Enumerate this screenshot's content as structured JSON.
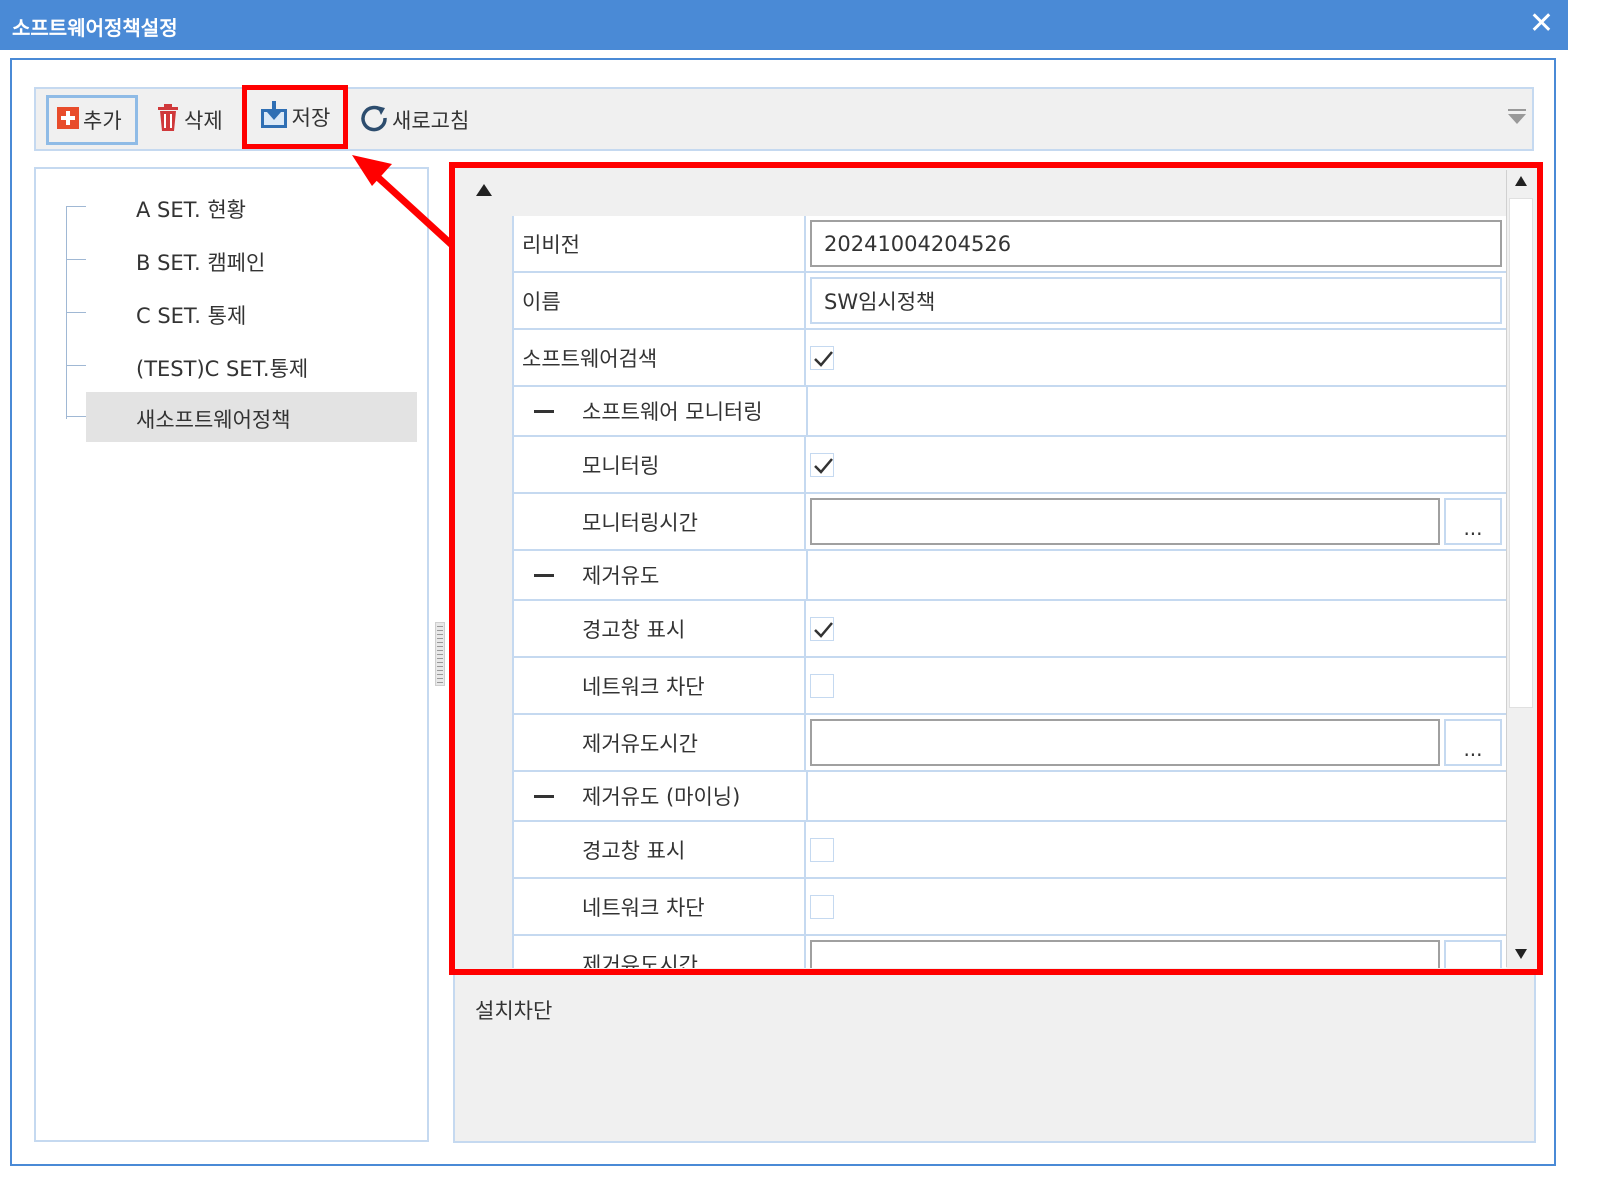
{
  "window": {
    "title": "소프트웨어정책설정",
    "close_glyph": "✕"
  },
  "toolbar": {
    "add_label": "추가",
    "delete_label": "삭제",
    "save_label": "저장",
    "refresh_label": "새로고침"
  },
  "tree": {
    "items": [
      {
        "label": "A SET. 현황",
        "selected": false
      },
      {
        "label": "B SET. 캠페인",
        "selected": false
      },
      {
        "label": "C SET. 통제",
        "selected": false
      },
      {
        "label": "(TEST)C SET.통제",
        "selected": false
      },
      {
        "label": "새소프트웨어정책",
        "selected": true
      }
    ]
  },
  "properties": {
    "rows": [
      {
        "type": "text",
        "label": "리비전",
        "value": "20241004204526"
      },
      {
        "type": "text",
        "label": "이름",
        "value": "SW임시정책"
      },
      {
        "type": "check",
        "label": "소프트웨어검색",
        "checked": true
      },
      {
        "type": "category",
        "label": "소프트웨어 모니터링"
      },
      {
        "type": "check",
        "label": "모니터링",
        "checked": true
      },
      {
        "type": "button",
        "label": "모니터링시간",
        "value": "",
        "button_label": "..."
      },
      {
        "type": "category",
        "label": "제거유도"
      },
      {
        "type": "check",
        "label": "경고창 표시",
        "checked": true
      },
      {
        "type": "check",
        "label": "네트워크 차단",
        "checked": false
      },
      {
        "type": "button",
        "label": "제거유도시간",
        "value": "",
        "button_label": "..."
      },
      {
        "type": "category",
        "label": "제거유도 (마이닝)"
      },
      {
        "type": "check",
        "label": "경고창 표시",
        "checked": false
      },
      {
        "type": "check",
        "label": "네트워크 차단",
        "checked": false
      },
      {
        "type": "button",
        "label": "제거유도시간",
        "value": "",
        "button_label": "..."
      }
    ]
  },
  "description": {
    "title": "설치차단"
  },
  "colors": {
    "titlebar": "#4a8ad6",
    "highlight": "#ff0000",
    "border": "#c5d9f0"
  }
}
